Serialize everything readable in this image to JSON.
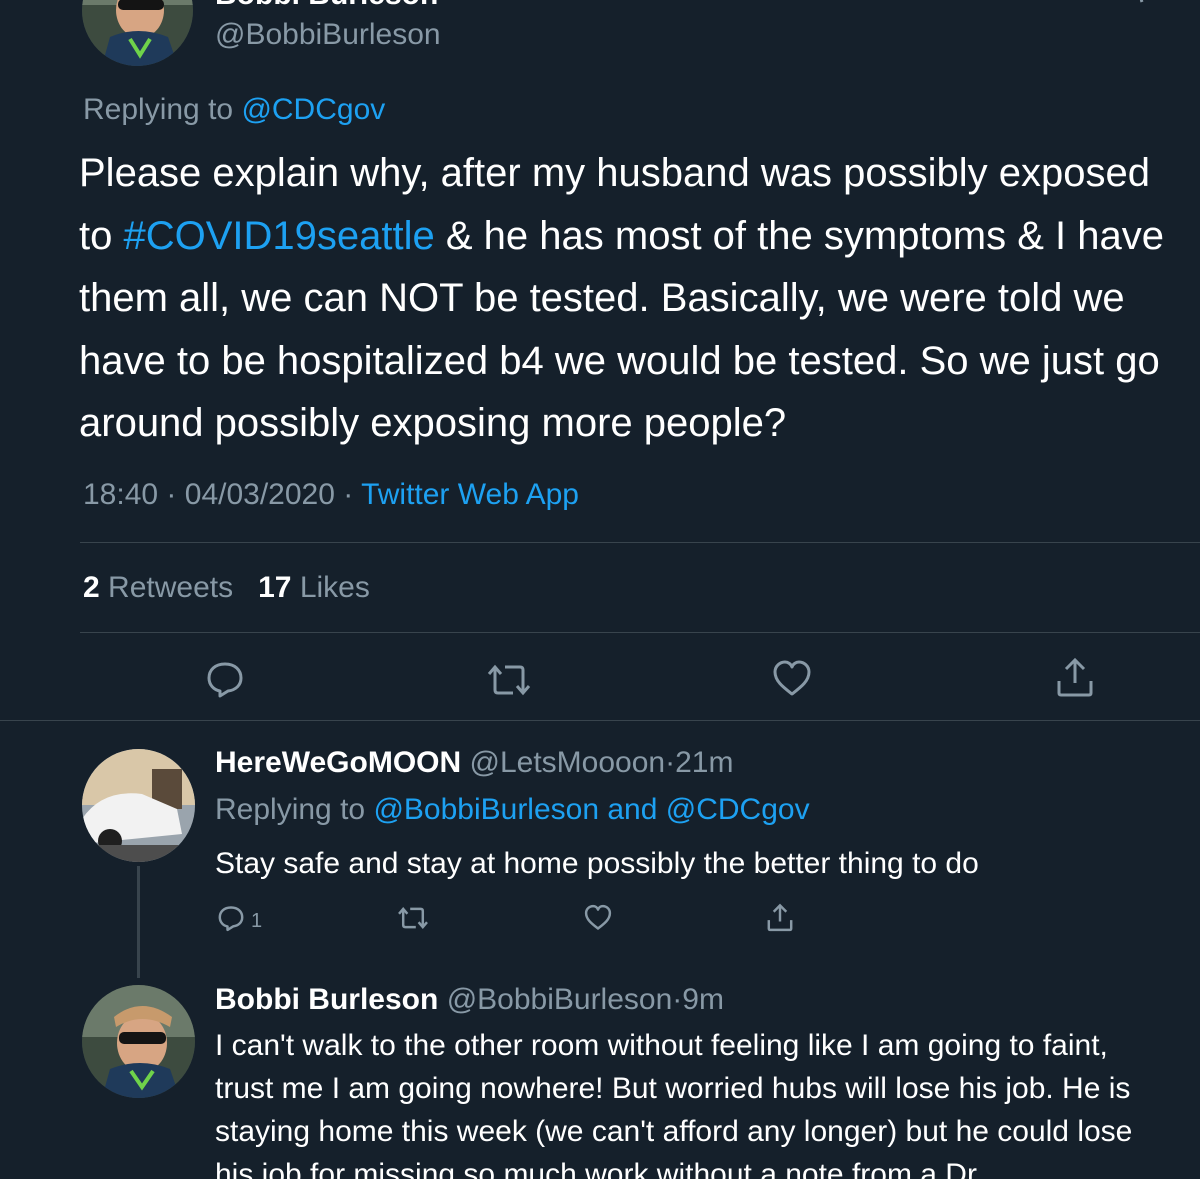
{
  "main_tweet": {
    "author_name": "Bobbi Burleson",
    "author_handle": "@BobbiBurleson",
    "replying_label": "Replying to",
    "replying_to": "@CDCgov",
    "text_parts": {
      "l1": "Please explain why, after my husband was possibly exposed",
      "l2_pre": "to ",
      "hashtag": "#COVID19seattle",
      "l2_post": " & he has most of the symptoms & I have",
      "l3": "them all, we can NOT be tested. Basically, we were told we",
      "l4": "have to be hospitalized b4 we would be tested. So we just go",
      "l5": "around possibly exposing more people?"
    },
    "time": "18:40",
    "date": "04/03/2020",
    "separator": "·",
    "source": "Twitter Web App",
    "retweet_count": "2",
    "retweet_label": "Retweets",
    "like_count": "17",
    "like_label": "Likes"
  },
  "reply_1": {
    "author_name": "HereWeGoMOON",
    "author_handle": "@LetsMoooon",
    "separator": "·",
    "time": "21m",
    "replying_label": "Replying to",
    "replying_to": "@BobbiBurleson and @CDCgov",
    "text": "Stay safe and stay at home possibly the better thing to do",
    "reply_count": "1"
  },
  "reply_2": {
    "author_name": "Bobbi Burleson",
    "author_handle": "@BobbiBurleson",
    "separator": "·",
    "time": "9m",
    "lines": {
      "l1": "I can't walk to the other room without feeling like I am going to faint,",
      "l2": "trust me I am going nowhere! But worried hubs will lose his job. He is",
      "l3": "staying home this week (we can't afford any longer) but he could lose",
      "l4": "his job for missing so much work without a note from a Dr."
    }
  },
  "colors": {
    "background": "#15202b",
    "muted": "#8899a6",
    "accent": "#1da1f2",
    "divider": "#38444d"
  },
  "icons": [
    "reply-icon",
    "retweet-icon",
    "like-icon",
    "share-icon"
  ]
}
